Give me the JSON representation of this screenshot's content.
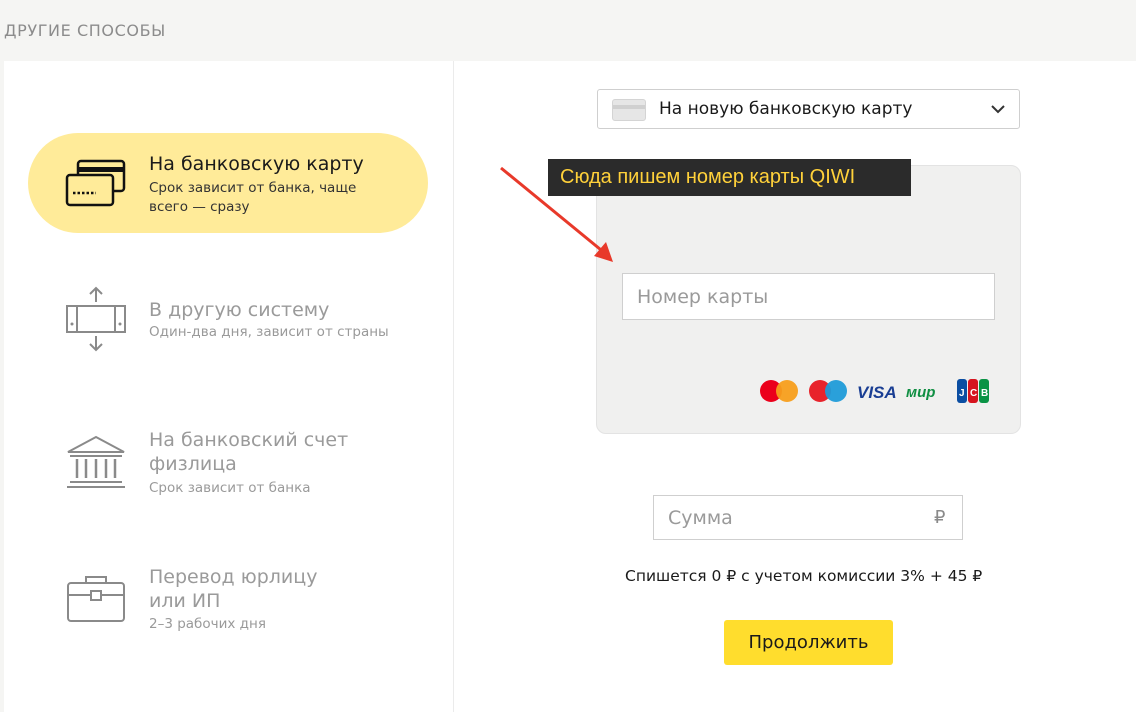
{
  "header": {
    "title": "ДРУГИЕ СПОСОБЫ"
  },
  "methods": [
    {
      "title": "На банковскую карту",
      "subtitle_line1": "Срок зависит от банка, чаще",
      "subtitle_line2": "всего — сразу",
      "icon": "bank-cards-icon",
      "active": true
    },
    {
      "title": "В другую систему",
      "subtitle_line1": "Один-два дня, зависит от страны",
      "icon": "transfer-system-icon",
      "active": false
    },
    {
      "title_line1": "На банковский счет",
      "title_line2": "физлица",
      "subtitle_line1": "Срок зависит от банка",
      "icon": "bank-building-icon",
      "active": false
    },
    {
      "title_line1": "Перевод юрлицу",
      "title_line2": "или ИП",
      "subtitle_line1": "2–3 рабочих дня",
      "icon": "briefcase-icon",
      "active": false
    }
  ],
  "form": {
    "card_select": {
      "selected": "На новую банковскую карту"
    },
    "tooltip": "Сюда пишем номер карты QIWI",
    "card_input": {
      "placeholder": "Номер карты"
    },
    "brands": {
      "visa": "VISA",
      "mir": "мир"
    },
    "sum_input": {
      "placeholder": "Сумма",
      "currency": "₽"
    },
    "fee_text": "Спишется 0  ₽ с учетом комиссии 3% + 45 ₽",
    "continue_label": "Продолжить"
  },
  "colors": {
    "accent_yellow": "#ffdd2d",
    "active_bg": "#ffeb99",
    "tooltip_text": "#ffd13a",
    "arrow_red": "#e8392a"
  }
}
